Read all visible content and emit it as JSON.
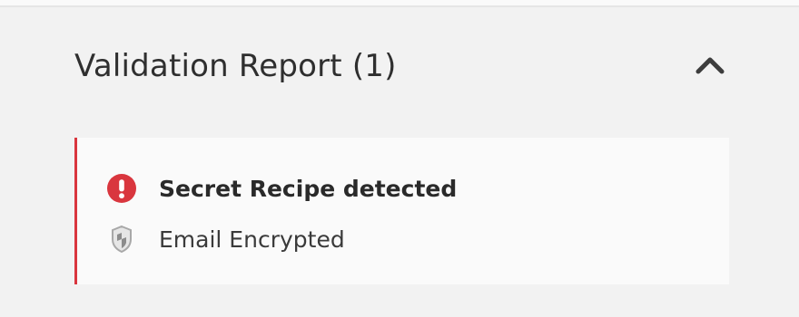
{
  "validation_report": {
    "title": "Validation Report (1)",
    "toggle_icon": "chevron-up-icon",
    "colors": {
      "error_accent": "#d9363e",
      "panel_background": "#f2f2f2",
      "card_background": "#fafafa"
    },
    "items": [
      {
        "icon": "error-exclamation-icon",
        "label": "Secret Recipe detected",
        "emphasis": "bold"
      },
      {
        "icon": "shield-icon",
        "label": "Email Encrypted",
        "emphasis": "normal"
      }
    ]
  }
}
